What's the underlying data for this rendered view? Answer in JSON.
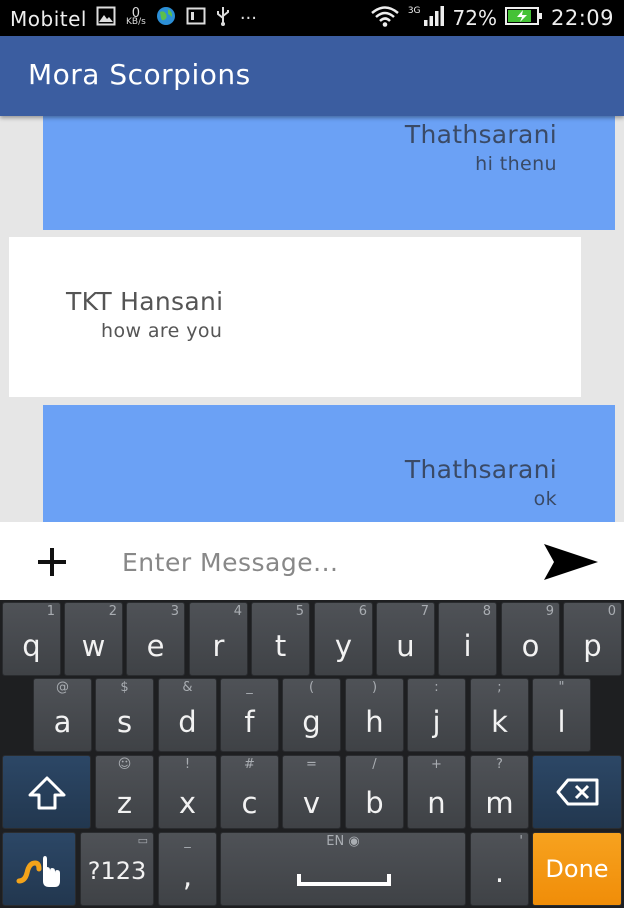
{
  "status_bar": {
    "carrier": "Mobitel",
    "speed_value": "0",
    "speed_unit": "KB/s",
    "network_type": "3G",
    "battery_percent": "72%",
    "time": "22:09",
    "overflow": "···"
  },
  "app_bar": {
    "title": "Mora Scorpions"
  },
  "messages": [
    {
      "sender": "Thathsarani",
      "text": "hi thenu",
      "side": "outgoing"
    },
    {
      "sender": "TKT Hansani",
      "text": "how are you",
      "side": "incoming"
    },
    {
      "sender": "Thathsarani",
      "text": "ok",
      "side": "outgoing"
    }
  ],
  "composer": {
    "placeholder": "Enter Message...",
    "value": "",
    "attach_icon": "plus-icon",
    "send_icon": "send-icon"
  },
  "keyboard": {
    "row1": [
      {
        "k": "q",
        "h": "1"
      },
      {
        "k": "w",
        "h": "2"
      },
      {
        "k": "e",
        "h": "3"
      },
      {
        "k": "r",
        "h": "4"
      },
      {
        "k": "t",
        "h": "5"
      },
      {
        "k": "y",
        "h": "6"
      },
      {
        "k": "u",
        "h": "7"
      },
      {
        "k": "i",
        "h": "8"
      },
      {
        "k": "o",
        "h": "9"
      },
      {
        "k": "p",
        "h": "0"
      }
    ],
    "row2": [
      {
        "k": "a",
        "h": "@"
      },
      {
        "k": "s",
        "h": "$"
      },
      {
        "k": "d",
        "h": "&"
      },
      {
        "k": "f",
        "h": "_"
      },
      {
        "k": "g",
        "h": "("
      },
      {
        "k": "h",
        "h": ")"
      },
      {
        "k": "j",
        "h": ":"
      },
      {
        "k": "k",
        "h": ";"
      },
      {
        "k": "l",
        "h": "\""
      }
    ],
    "row3": [
      {
        "k": "z",
        "h": "☺"
      },
      {
        "k": "x",
        "h": "!"
      },
      {
        "k": "c",
        "h": "#"
      },
      {
        "k": "v",
        "h": "="
      },
      {
        "k": "b",
        "h": "/"
      },
      {
        "k": "n",
        "h": "+"
      },
      {
        "k": "m",
        "h": "?"
      }
    ],
    "symbols_label": "?123",
    "comma_label": ",",
    "comma_hint": "_",
    "space_language": "EN",
    "period_label": ".",
    "period_hint": "'",
    "done_label": "Done"
  }
}
